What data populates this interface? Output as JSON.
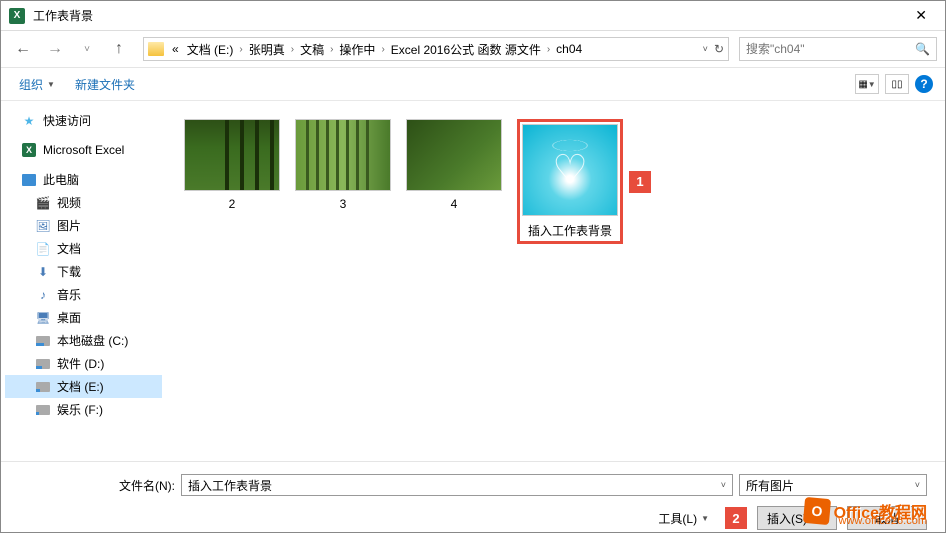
{
  "titlebar": {
    "title": "工作表背景"
  },
  "nav": {
    "crumbs": [
      "文档 (E:)",
      "张明真",
      "文稿",
      "操作中",
      "Excel 2016公式 函数 源文件",
      "ch04"
    ],
    "prefix": "«",
    "search_placeholder": "搜索\"ch04\""
  },
  "toolbar": {
    "organize": "组织",
    "new_folder": "新建文件夹"
  },
  "sidebar": {
    "quick_access": "快速访问",
    "excel": "Microsoft Excel",
    "this_pc": "此电脑",
    "videos": "视频",
    "pictures": "图片",
    "documents": "文档",
    "downloads": "下载",
    "music": "音乐",
    "desktop": "桌面",
    "disk_c": "本地磁盘 (C:)",
    "disk_d": "软件 (D:)",
    "disk_e": "文档 (E:)",
    "disk_f": "娱乐 (F:)"
  },
  "files": {
    "f1": "2",
    "f2": "3",
    "f3": "4",
    "f4": "插入工作表背景"
  },
  "badges": {
    "b1": "1",
    "b2": "2"
  },
  "bottom": {
    "filename_label": "文件名(N):",
    "filename_value": "插入工作表背景",
    "filter": "所有图片",
    "tools": "工具(L)",
    "insert": "插入(S)",
    "cancel": "取消"
  },
  "watermark": {
    "brand": "Office教程网",
    "url": "www.office26.com"
  }
}
